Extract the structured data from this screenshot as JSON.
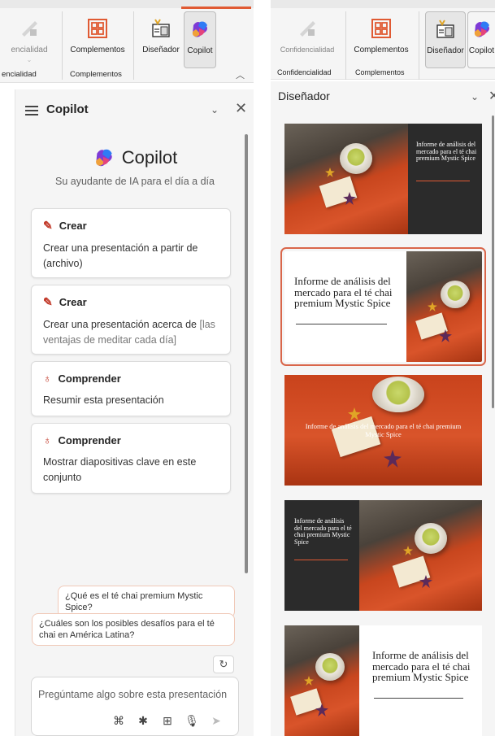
{
  "left_ribbon": {
    "btn_sensitivity": "encialidad",
    "btn_addins": "Complementos",
    "btn_designer": "Diseñador",
    "btn_copilot": "Copilot",
    "group_sensitivity": "encialidad",
    "group_addins": "Complementos"
  },
  "copilot": {
    "pane_title": "Copilot",
    "brand": "Copilot",
    "subtitle": "Su ayudante de IA para el día a día",
    "cards": [
      {
        "heading": "Crear",
        "body": "Crear una presentación a partir de (archivo)"
      },
      {
        "heading": "Crear",
        "body_main": "Crear una presentación acerca de ",
        "body_hint": "[las ventajas de meditar cada día]"
      },
      {
        "heading": "Comprender",
        "body": "Resumir esta presentación"
      },
      {
        "heading": "Comprender",
        "body": "Mostrar diapositivas clave en este conjunto"
      }
    ],
    "suggestions": [
      "¿Qué es el té chai premium Mystic Spice?",
      "¿Cuáles son los posibles desafíos para el té chai en América Latina?"
    ],
    "input_placeholder": "Pregúntame algo sobre esta presentación"
  },
  "right_ribbon": {
    "btn_sensitivity": "Confidencialidad",
    "btn_addins": "Complementos",
    "btn_designer": "Diseñador",
    "btn_copilot": "Copilot",
    "group_sensitivity": "Confidencialidad",
    "group_addins": "Complementos"
  },
  "designer": {
    "pane_title": "Diseñador",
    "slide_title_lines": [
      "Informe de",
      "análisis del",
      "mercado para el",
      "té chai premium",
      "Mystic Spice"
    ],
    "slide_title": "Informe de análisis del mercado para el té chai premium Mystic Spice"
  },
  "colors": {
    "accent": "#d9664a",
    "copilot_gradient": [
      "#2f7bf5",
      "#7e3bd6",
      "#e4447c",
      "#f0a13a"
    ]
  }
}
